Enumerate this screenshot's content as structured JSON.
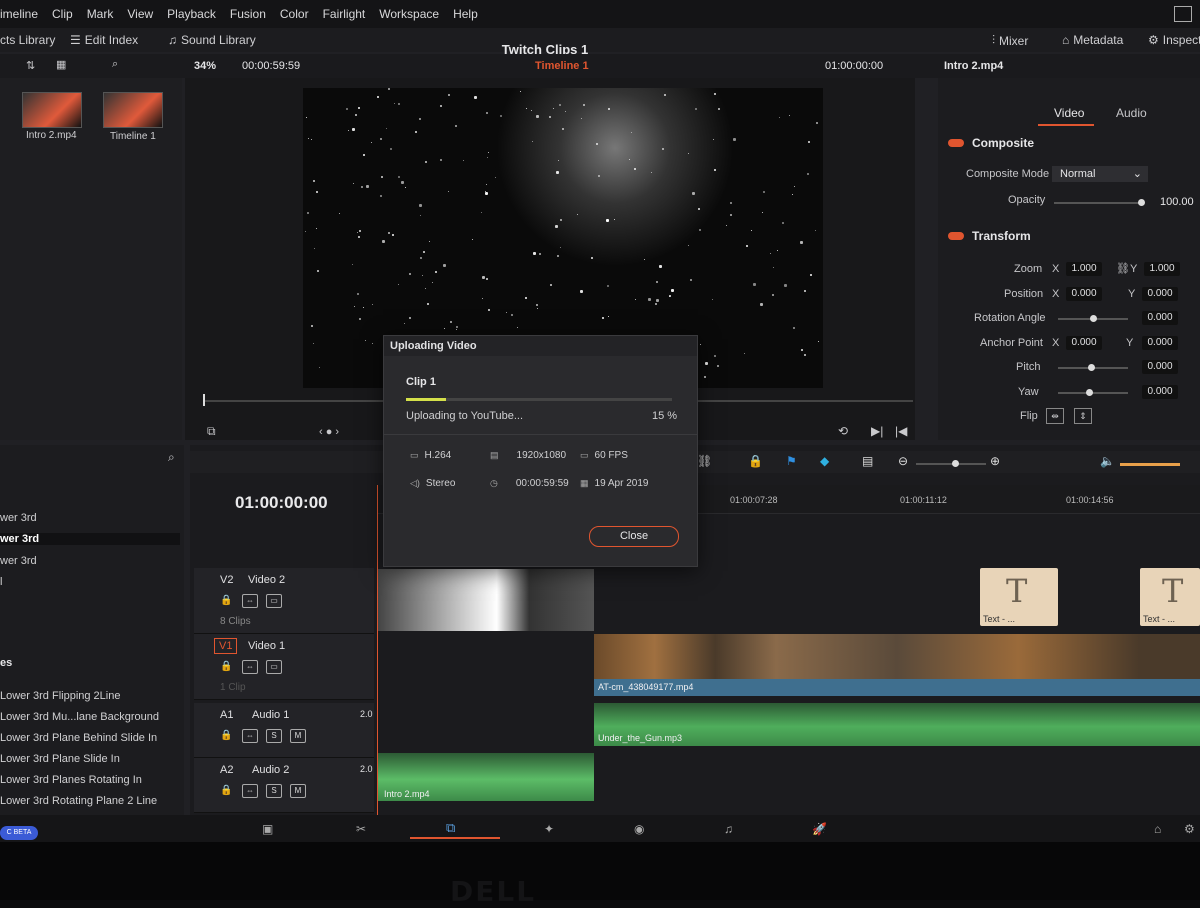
{
  "menu": [
    "imeline",
    "Clip",
    "Mark",
    "View",
    "Playback",
    "Fusion",
    "Color",
    "Fairlight",
    "Workspace",
    "Help"
  ],
  "toolbar": {
    "effects_library": "cts Library",
    "edit_index": "Edit Index",
    "sound_library": "Sound Library",
    "project_title": "Twitch Clips 1",
    "mixer": "Mixer",
    "metadata": "Metadata",
    "inspector": "Inspecto"
  },
  "viewer": {
    "zoom": "34%",
    "timecode": "00:00:59:59",
    "timeline_name": "Timeline 1",
    "source_timecode": "01:00:00:00",
    "clip_name": "Intro 2.mp4"
  },
  "media_pool": {
    "items": [
      {
        "label": "Intro 2.mp4"
      },
      {
        "label": "Timeline 1"
      }
    ]
  },
  "inspector": {
    "tabs": [
      "Video",
      "Audio"
    ],
    "composite": {
      "header": "Composite",
      "mode_label": "Composite Mode",
      "mode_value": "Normal",
      "opacity_label": "Opacity",
      "opacity_value": "100.00"
    },
    "transform": {
      "header": "Transform",
      "zoom_label": "Zoom",
      "zoom_x": "1.000",
      "zoom_y": "1.000",
      "position_label": "Position",
      "position_x": "0.000",
      "position_y": "0.000",
      "rotation_label": "Rotation Angle",
      "rotation_value": "0.000",
      "anchor_label": "Anchor Point",
      "anchor_x": "0.000",
      "anchor_y": "0.000",
      "pitch_label": "Pitch",
      "pitch_value": "0.000",
      "yaw_label": "Yaw",
      "yaw_value": "0.000",
      "flip_label": "Flip",
      "x": "X",
      "y": "Y"
    }
  },
  "effects": {
    "items_top": [
      "wer 3rd",
      "wer 3rd",
      "wer 3rd",
      "l"
    ],
    "section": "es",
    "titles": [
      "Lower 3rd Flipping 2Line",
      "Lower 3rd Mu...lane Background",
      "Lower 3rd Plane Behind Slide In",
      "Lower 3rd Plane Slide In",
      "Lower 3rd Planes Rotating In",
      "Lower 3rd Rotating Plane 2 Line"
    ]
  },
  "timeline": {
    "timecode": "01:00:00:00",
    "ruler": [
      "01:00:07:28",
      "01:00:11:12",
      "01:00:14:56"
    ],
    "tracks": [
      {
        "id": "V2",
        "name": "Video 2",
        "clips": "8 Clips"
      },
      {
        "id": "V1",
        "name": "Video 1",
        "clips": "1 Clip"
      },
      {
        "id": "A1",
        "name": "Audio 1",
        "level": "2.0"
      },
      {
        "id": "A2",
        "name": "Audio 2",
        "level": "2.0"
      }
    ],
    "clip_labels": {
      "v1": "AT-cm_438049177.mp4",
      "a1": "Under_the_Gun.mp3",
      "a2": "Intro 2.mp4",
      "text": "Text - ...",
      "text_glyph": "T"
    },
    "btn_s": "S",
    "btn_m": "M"
  },
  "dialog": {
    "title": "Uploading Video",
    "clip_name": "Clip 1",
    "status": "Uploading to YouTube...",
    "progress_text": "15 %",
    "progress": 0.15,
    "codec": "H.264",
    "resolution": "1920x1080",
    "fps": "60 FPS",
    "audio": "Stereo",
    "duration": "00:00:59:59",
    "date": "19 Apr 2019",
    "close": "Close"
  },
  "beta_badge": "C BETA",
  "accent": "#e0552f"
}
